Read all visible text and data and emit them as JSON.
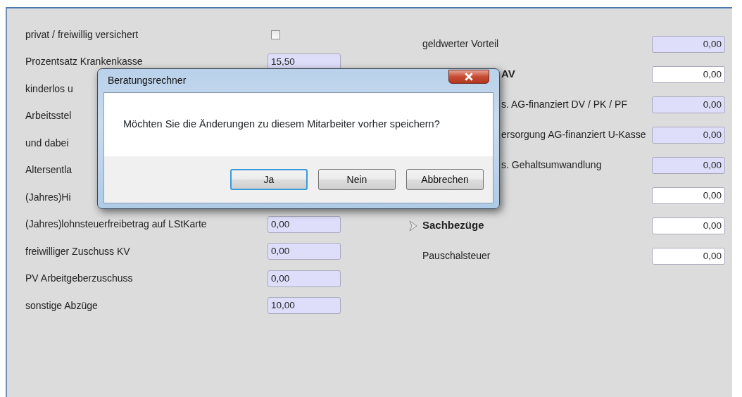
{
  "left_rows": [
    {
      "label": "privat / freiwillig versichert",
      "kind": "checkbox",
      "checked": false
    },
    {
      "label": "Prozentsatz Krankenkasse",
      "kind": "field",
      "value": "15,50",
      "editable": false
    },
    {
      "label": "kinderlos u",
      "kind": "hidden"
    },
    {
      "label": "Arbeitsstel",
      "kind": "hidden"
    },
    {
      "label": "und dabei",
      "kind": "hidden"
    },
    {
      "label": "Altersentla",
      "kind": "hidden"
    },
    {
      "label": "(Jahres)Hi",
      "kind": "hidden"
    },
    {
      "label": "(Jahres)lohnsteuerfreibetrag auf LStKarte",
      "kind": "field",
      "value": "0,00",
      "editable": false
    },
    {
      "label": "freiwilliger Zuschuss KV",
      "kind": "field",
      "value": "0,00",
      "editable": false
    },
    {
      "label": "PV Arbeitgeberzuschuss",
      "kind": "field",
      "value": "0,00",
      "editable": false
    },
    {
      "label": "sonstige Abzüge",
      "kind": "field",
      "value": "10,00",
      "editable": false
    }
  ],
  "right_rows": [
    {
      "label": "geldwerter Vorteil",
      "kind": "label",
      "value": "0,00",
      "editable": false
    },
    {
      "label": "AV",
      "kind": "header_covered",
      "value": "0,00",
      "editable": true
    },
    {
      "label": "s. AG-finanziert DV / PK / PF",
      "kind": "covered",
      "value": "0,00",
      "editable": false
    },
    {
      "label": "ersorgung AG-finanziert U-Kasse",
      "kind": "covered",
      "value": "0,00",
      "editable": false
    },
    {
      "label": "s. Gehaltsumwandlung",
      "kind": "covered",
      "value": "0,00",
      "editable": false
    },
    {
      "kind": "blank",
      "value": "0,00",
      "editable": true
    },
    {
      "label": "Sachbezüge",
      "kind": "header",
      "value": "0,00",
      "editable": true
    },
    {
      "label": "Pauschalsteuer",
      "kind": "label",
      "value": "0,00",
      "editable": true
    }
  ],
  "dialog": {
    "title": "Beratungsrechner",
    "message": "Möchten Sie die Änderungen zu diesem Mitarbeiter vorher speichern?",
    "buttons": [
      {
        "label": "Ja",
        "focused": true
      },
      {
        "label": "Nein",
        "focused": false
      },
      {
        "label": "Abbrechen",
        "focused": false
      }
    ]
  }
}
